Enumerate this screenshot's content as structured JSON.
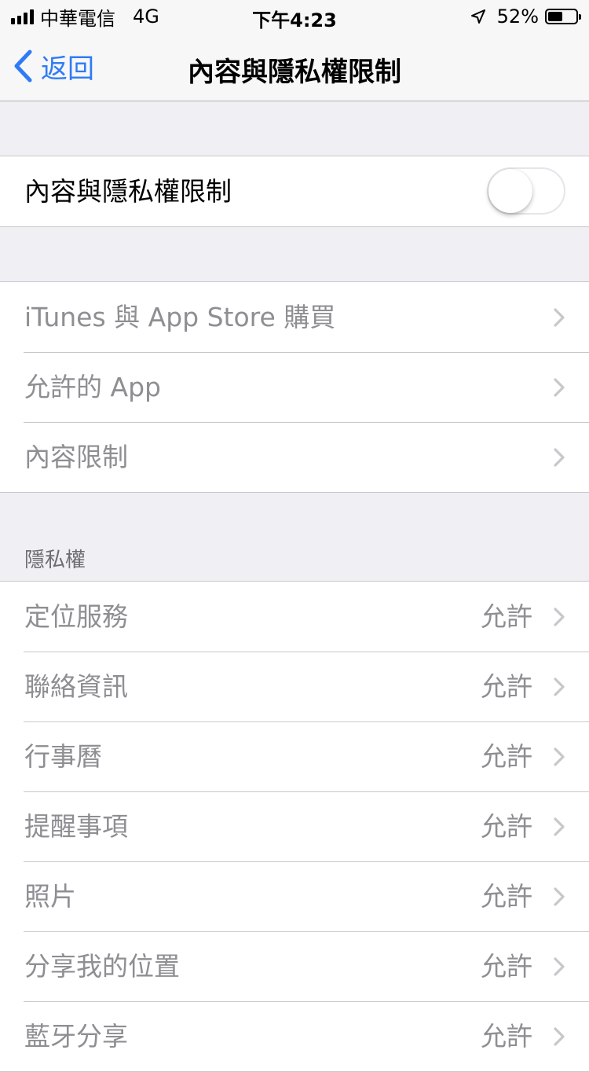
{
  "status_bar": {
    "carrier": "中華電信",
    "network": "4G",
    "time": "下午4:23",
    "battery_percent": "52%",
    "battery_level": 0.52,
    "signal_bars": 4
  },
  "nav": {
    "back_label": "返回",
    "title": "內容與隱私權限制"
  },
  "main_toggle": {
    "label": "內容與隱私權限制",
    "on": false
  },
  "store_group": [
    {
      "label": "iTunes 與 App Store 購買"
    },
    {
      "label": "允許的 App"
    },
    {
      "label": "內容限制"
    }
  ],
  "privacy": {
    "header": "隱私權",
    "items": [
      {
        "label": "定位服務",
        "value": "允許"
      },
      {
        "label": "聯絡資訊",
        "value": "允許"
      },
      {
        "label": "行事曆",
        "value": "允許"
      },
      {
        "label": "提醒事項",
        "value": "允許"
      },
      {
        "label": "照片",
        "value": "允許"
      },
      {
        "label": "分享我的位置",
        "value": "允許"
      },
      {
        "label": "藍牙分享",
        "value": "允許"
      }
    ]
  },
  "colors": {
    "accent": "#2f7bf5",
    "background": "#efeff4",
    "secondary_text": "#8e8e93"
  }
}
